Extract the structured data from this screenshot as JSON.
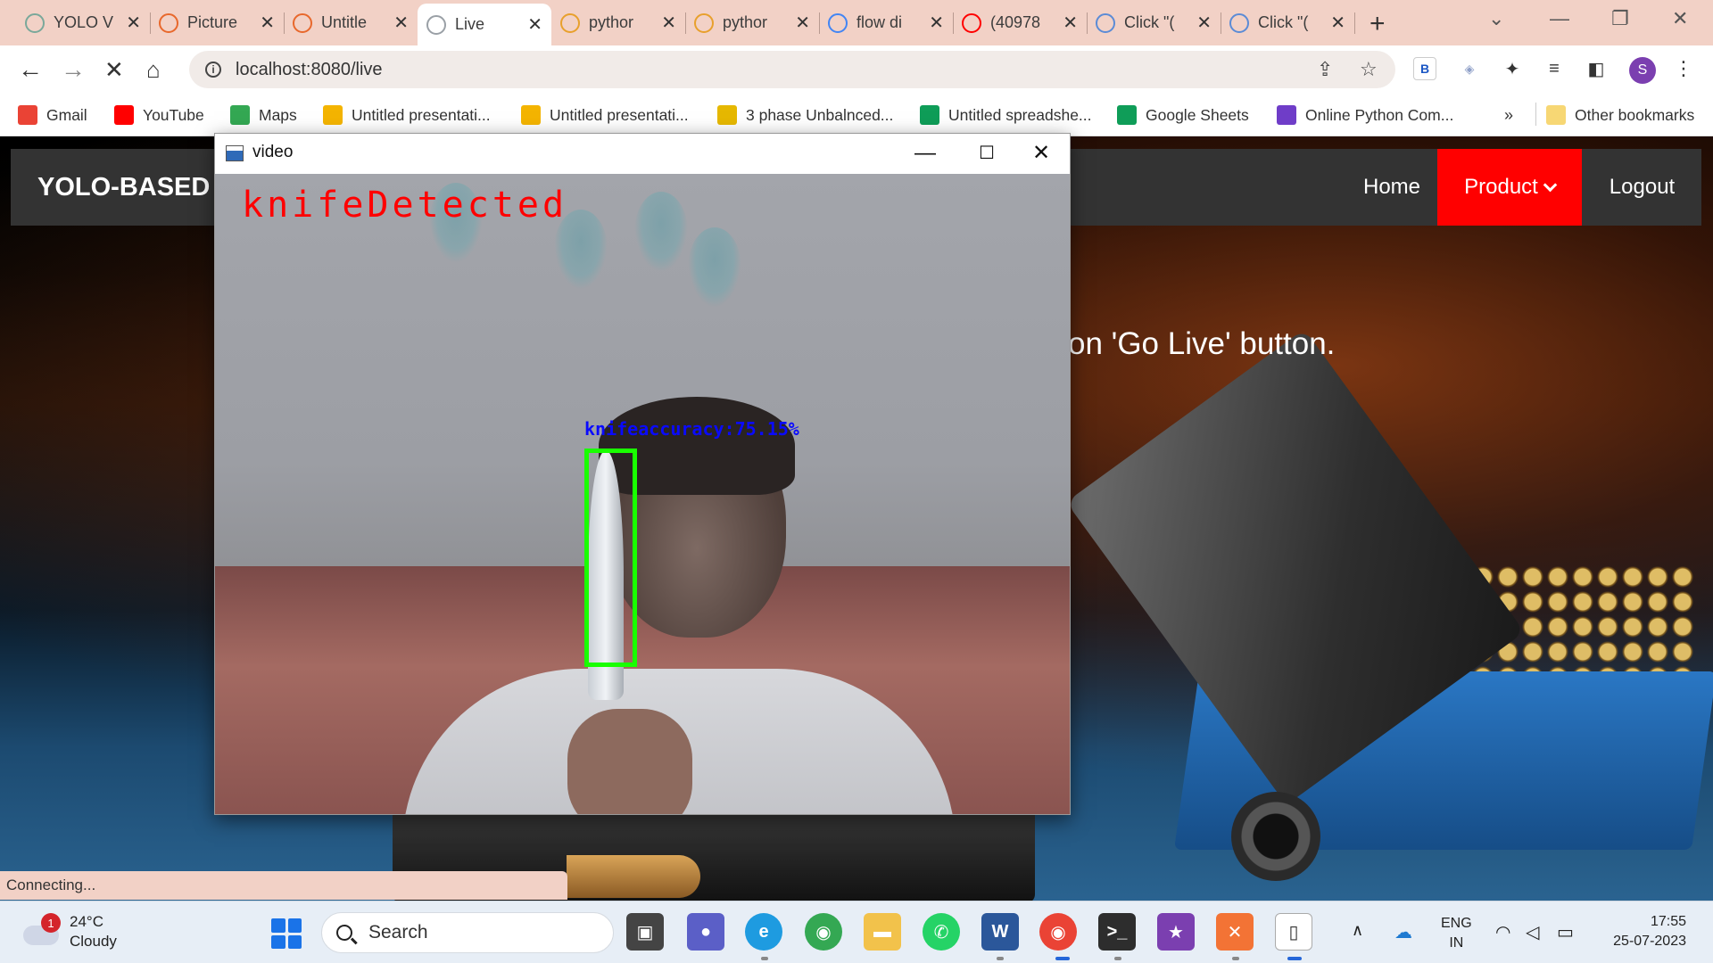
{
  "browser": {
    "tabs": [
      {
        "title": "YOLO V",
        "icon": "chatgpt-icon",
        "color": "#7aa89a"
      },
      {
        "title": "Picture",
        "icon": "loading-icon",
        "color": "#e8682c"
      },
      {
        "title": "Untitle",
        "icon": "hourglass-icon",
        "color": "#e8682c"
      },
      {
        "title": "Live",
        "icon": "loading-icon",
        "color": "#9aa0a6",
        "active": true
      },
      {
        "title": "pythor",
        "icon": "sublime-icon",
        "color": "#e8a02c"
      },
      {
        "title": "pythor",
        "icon": "sublime-icon",
        "color": "#e8a02c"
      },
      {
        "title": "flow di",
        "icon": "google-icon",
        "color": "#4285f4"
      },
      {
        "title": "(40978",
        "icon": "youtube-icon",
        "color": "#ff0000"
      },
      {
        "title": "Click \"(",
        "icon": "drawio-icon",
        "color": "#5b8bd6"
      },
      {
        "title": "Click \"(",
        "icon": "drawio-icon",
        "color": "#5b8bd6"
      }
    ],
    "url": "localhost:8080/live",
    "bookmarks": [
      {
        "label": "Gmail",
        "icon": "gmail-icon",
        "color": "#ea4335"
      },
      {
        "label": "YouTube",
        "icon": "youtube-icon",
        "color": "#ff0000"
      },
      {
        "label": "Maps",
        "icon": "maps-icon",
        "color": "#34a853"
      },
      {
        "label": "Untitled presentati...",
        "icon": "slides-icon",
        "color": "#f4b400"
      },
      {
        "label": "Untitled presentati...",
        "icon": "slides-icon",
        "color": "#f4b400"
      },
      {
        "label": "3 phase Unbalnced...",
        "icon": "bookmark-icon",
        "color": "#e6b800"
      },
      {
        "label": "Untitled spreadshe...",
        "icon": "sheets-icon",
        "color": "#0f9d58"
      },
      {
        "label": "Google Sheets",
        "icon": "sheets-icon",
        "color": "#0f9d58"
      },
      {
        "label": "Online Python Com...",
        "icon": "python-icon",
        "color": "#6f3dc8"
      }
    ],
    "bookmarks_overflow": "»",
    "other_bookmarks": "Other bookmarks",
    "status": "Connecting...",
    "profile_initial": "S"
  },
  "site": {
    "brand": "YOLO-BASED",
    "nav": {
      "home": "Home",
      "product": "Product",
      "logout": "Logout"
    },
    "hero_text": "on 'Go Live' button."
  },
  "video_window": {
    "title": "video",
    "detection_label": "knifeDetected",
    "bbox_label": "knifeaccuracy:75.15%",
    "accuracy_percent": 75.15,
    "label_color": "#ff0000",
    "bbox_color": "#19ff00",
    "bbox_text_color": "#0a0aff"
  },
  "taskbar": {
    "weather_temp": "24°C",
    "weather_desc": "Cloudy",
    "weather_badge": "1",
    "search_label": "Search",
    "lang_line1": "ENG",
    "lang_line2": "IN",
    "time": "17:55",
    "date": "25-07-2023"
  }
}
